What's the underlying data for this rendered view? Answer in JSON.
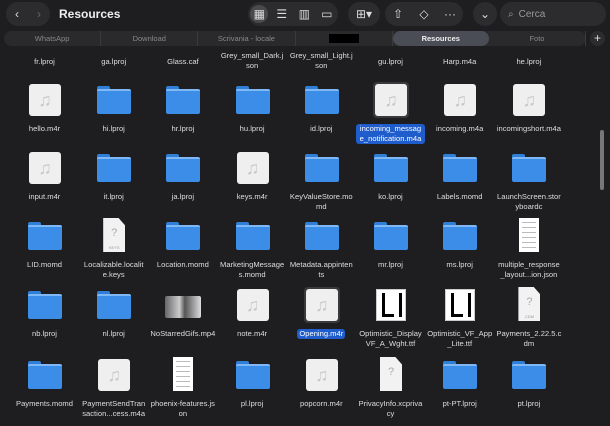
{
  "window": {
    "title": "Resources",
    "search_placeholder": "Cerca"
  },
  "tabs": [
    {
      "label": "WhatsApp"
    },
    {
      "label": "Download"
    },
    {
      "label": "Scrivania - locale"
    },
    {
      "label": ""
    },
    {
      "label": "Resources",
      "selected": true
    },
    {
      "label": "Foto"
    }
  ],
  "top_row": [
    "fr.lproj",
    "ga.lproj",
    "Glass.caf",
    "Grey_small_Dark.json",
    "Grey_small_Light.json",
    "gu.lproj",
    "Harp.m4a",
    "he.lproj"
  ],
  "files": [
    [
      {
        "name": "hello.m4r",
        "type": "audio"
      },
      {
        "name": "hi.lproj",
        "type": "folder"
      },
      {
        "name": "hr.lproj",
        "type": "folder"
      },
      {
        "name": "hu.lproj",
        "type": "folder"
      },
      {
        "name": "id.lproj",
        "type": "folder"
      },
      {
        "name": "incoming_message_notification.m4a",
        "type": "audio",
        "selected": true
      },
      {
        "name": "incoming.m4a",
        "type": "audio"
      },
      {
        "name": "incomingshort.m4a",
        "type": "audio"
      }
    ],
    [
      {
        "name": "input.m4r",
        "type": "audio"
      },
      {
        "name": "it.lproj",
        "type": "folder"
      },
      {
        "name": "ja.lproj",
        "type": "folder"
      },
      {
        "name": "keys.m4r",
        "type": "audio"
      },
      {
        "name": "KeyValueStore.momd",
        "type": "folder"
      },
      {
        "name": "ko.lproj",
        "type": "folder"
      },
      {
        "name": "Labels.momd",
        "type": "folder"
      },
      {
        "name": "LaunchScreen.storyboardc",
        "type": "folder"
      }
    ],
    [
      {
        "name": "LID.momd",
        "type": "folder"
      },
      {
        "name": "Localizable.localite.keys",
        "type": "doc",
        "badge": "KEYS"
      },
      {
        "name": "Location.momd",
        "type": "folder"
      },
      {
        "name": "MarketingMessages.momd",
        "type": "folder"
      },
      {
        "name": "Metadata.appintents",
        "type": "folder"
      },
      {
        "name": "mr.lproj",
        "type": "folder"
      },
      {
        "name": "ms.lproj",
        "type": "folder"
      },
      {
        "name": "multiple_response_layout...ion.json",
        "type": "json"
      }
    ],
    [
      {
        "name": "nb.lproj",
        "type": "folder"
      },
      {
        "name": "nl.lproj",
        "type": "folder"
      },
      {
        "name": "NoStarredGifs.mp4",
        "type": "video"
      },
      {
        "name": "note.m4r",
        "type": "audio"
      },
      {
        "name": "Opening.m4r",
        "type": "audio",
        "selected": true
      },
      {
        "name": "Optimistic_DisplayVF_A_Wght.ttf",
        "type": "font"
      },
      {
        "name": "Optimistic_VF_App_Lite.ttf",
        "type": "font"
      },
      {
        "name": "Payments_2.22.5.cdm",
        "type": "doc",
        "badge": "CDM"
      }
    ],
    [
      {
        "name": "Payments.momd",
        "type": "folder"
      },
      {
        "name": "PaymentSendTransaction...cess.m4a",
        "type": "audio"
      },
      {
        "name": "phoenix-features.json",
        "type": "json"
      },
      {
        "name": "pl.lproj",
        "type": "folder"
      },
      {
        "name": "popcorn.m4r",
        "type": "audio"
      },
      {
        "name": "PrivacyInfo.xcprivacy",
        "type": "doc",
        "badge": ""
      },
      {
        "name": "pt-PT.lproj",
        "type": "folder"
      },
      {
        "name": "pt.lproj",
        "type": "folder"
      }
    ]
  ]
}
